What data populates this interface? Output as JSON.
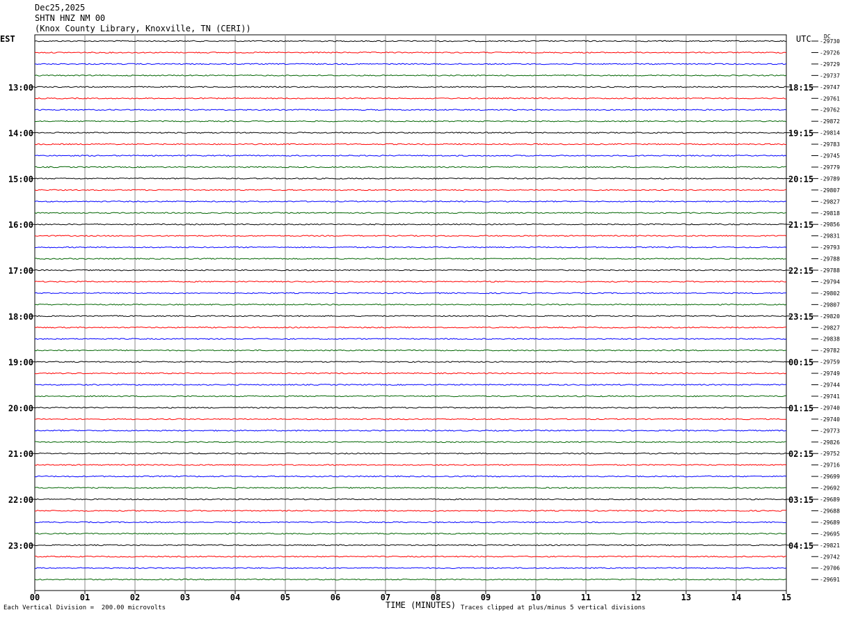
{
  "header": {
    "date": "Dec25,2025",
    "station": "SHTN HNZ NM 00",
    "location": "(Knox County Library, Knoxville, TN (CERI))"
  },
  "left_label": "EST",
  "right_label": "UTC",
  "dc_label": "DC",
  "footer": {
    "xlabel": "TIME (MINUTES)",
    "scale_note": "Each Vertical Division =  200.00 microvolts",
    "clip_note": "Traces clipped at plus/minus 5 vertical divisions"
  },
  "colors": {
    "black": "#000000",
    "red": "#ff0000",
    "blue": "#0000ff",
    "green": "#006400",
    "grid": "#888888"
  },
  "chart_data": {
    "type": "line",
    "xlabel": "TIME (MINUTES)",
    "xlim": [
      0,
      15
    ],
    "x_ticks": [
      "00",
      "01",
      "02",
      "03",
      "04",
      "05",
      "06",
      "07",
      "08",
      "09",
      "10",
      "11",
      "12",
      "13",
      "14",
      "15"
    ],
    "left_hour_labels": [
      "13:00",
      "14:00",
      "15:00",
      "16:00",
      "17:00",
      "18:00",
      "19:00",
      "20:00",
      "21:00",
      "22:00",
      "23:00"
    ],
    "right_hour_labels": [
      "18:15",
      "19:15",
      "20:15",
      "21:15",
      "22:15",
      "23:15",
      "00:15",
      "01:15",
      "02:15",
      "03:15",
      "04:15"
    ],
    "color_cycle": [
      "black",
      "red",
      "blue",
      "green"
    ],
    "dc_offsets": [
      -29730,
      -29726,
      -29729,
      -29737,
      -29747,
      -29761,
      -29762,
      -29872,
      -29814,
      -29783,
      -29745,
      -29779,
      -29789,
      -29807,
      -29827,
      -29818,
      -29856,
      -29831,
      -29793,
      -29788,
      -29788,
      -29794,
      -29802,
      -29807,
      -29820,
      -29827,
      -29838,
      -29782,
      -29759,
      -29749,
      -29744,
      -29741,
      -29740,
      -29740,
      -29773,
      -29826,
      -29752,
      -29716,
      -29699,
      -29692,
      -29689,
      -29688,
      -29689,
      -29695,
      -29821,
      -29742,
      -29706,
      -29691
    ]
  }
}
